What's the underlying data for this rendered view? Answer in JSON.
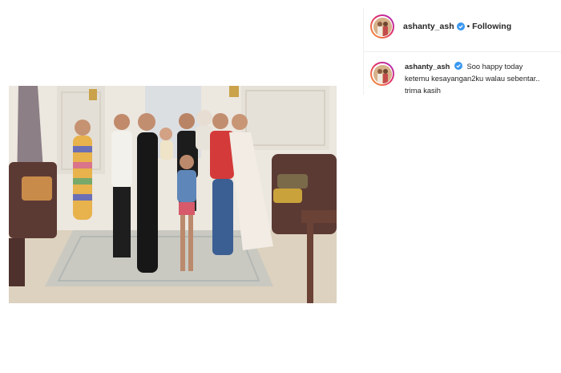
{
  "post": {
    "username": "ashanty_ash",
    "separator": "•",
    "follow_status": "Following",
    "verified_icon": "verified-badge-icon",
    "accent_color": "#3897f0"
  },
  "caption": {
    "username": "ashanty_ash",
    "text": "Soo happy today ketemu kesayangan2ku walau sebentar.. trima kasih"
  }
}
